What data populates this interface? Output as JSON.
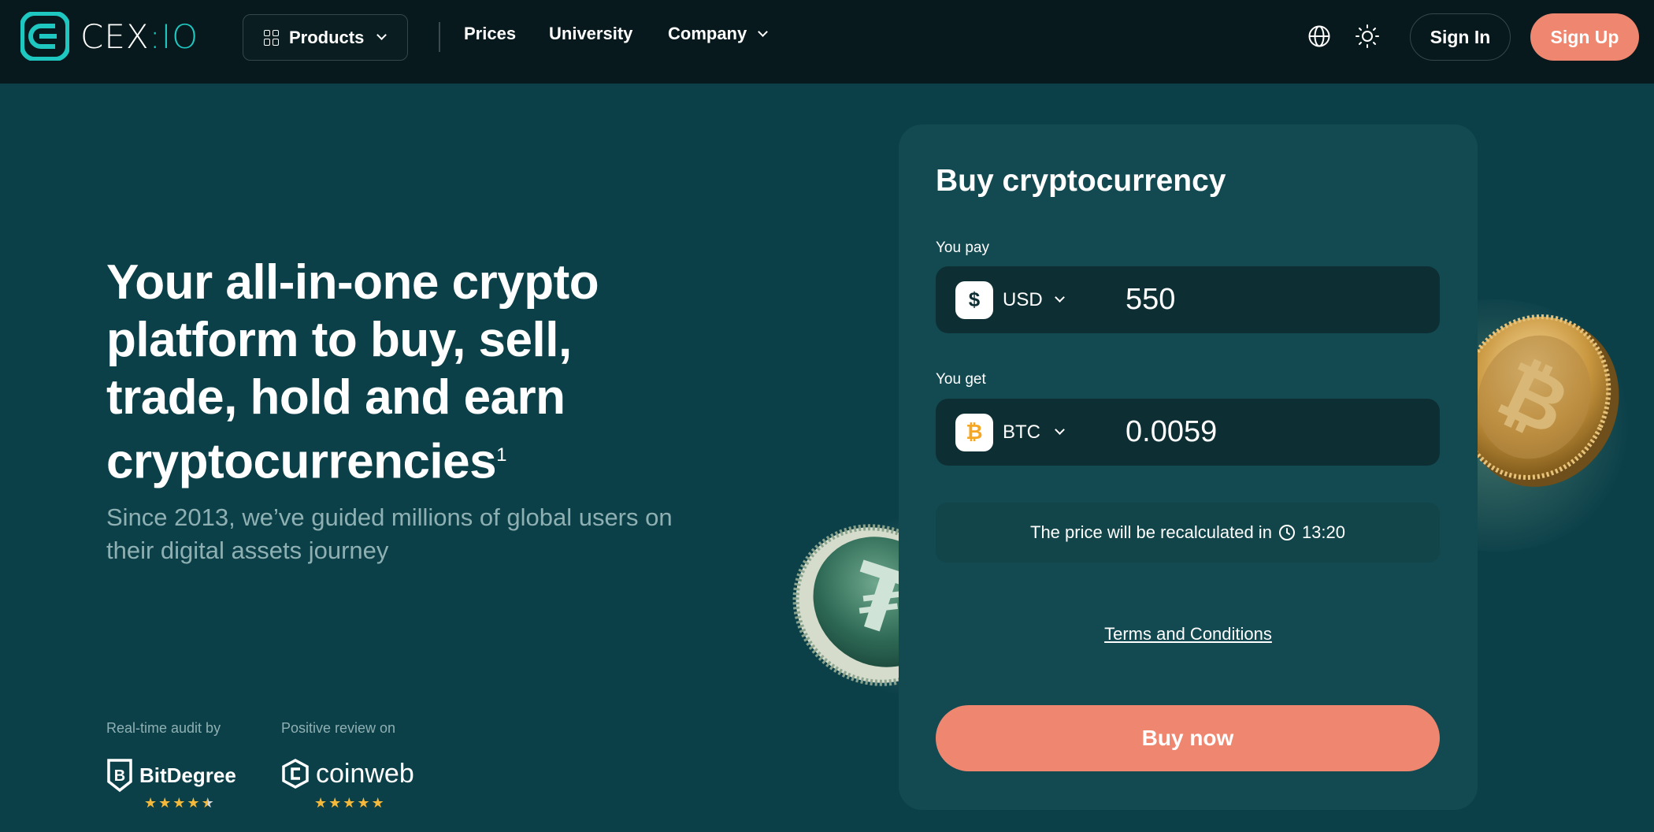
{
  "brand": {
    "name": "CEX",
    "suffix": "IO",
    "accent": "#1fc7c1",
    "cta_color": "#ef8770"
  },
  "header": {
    "products_label": "Products",
    "nav": [
      {
        "label": "Prices"
      },
      {
        "label": "University"
      },
      {
        "label": "Company"
      }
    ],
    "sign_in": "Sign In",
    "sign_up": "Sign Up"
  },
  "hero": {
    "title": "Your all-in-one crypto platform to buy, sell, trade, hold and earn cryptocurrencies",
    "title_sup": "1",
    "subtitle": "Since 2013, we’ve guided millions of global users on their digital assets journey"
  },
  "trust": {
    "audit_label": "Real-time audit by",
    "audit_brand": "BitDegree",
    "audit_rating": 4.5,
    "review_label": "Positive review on",
    "review_brand": "coinweb",
    "review_rating": 5
  },
  "buy_card": {
    "title": "Buy cryptocurrency",
    "pay_label": "You pay",
    "pay_currency": "USD",
    "pay_symbol": "$",
    "pay_amount": "550",
    "get_label": "You get",
    "get_currency": "BTC",
    "get_symbol": "₿",
    "get_amount": "0.0059",
    "recalc_text": "The price will be recalculated in",
    "recalc_time": "13:20",
    "terms_link": "Terms and Conditions",
    "buy_button": "Buy now"
  }
}
